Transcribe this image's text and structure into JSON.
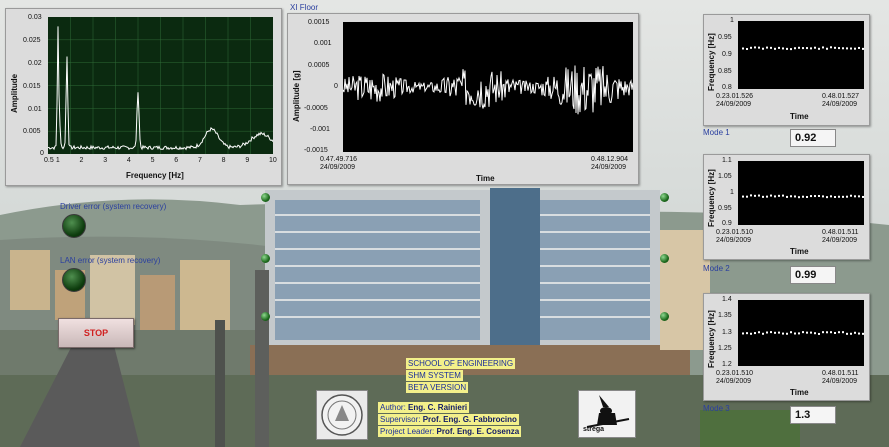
{
  "spectrum": {
    "ylabel": "Amplitude",
    "xlabel": "Frequency [Hz]",
    "yticks": [
      "0.03",
      "0.025",
      "0.02",
      "0.015",
      "0.01",
      "0.005",
      "0"
    ],
    "xticks": [
      "0.5",
      "1",
      "2",
      "3",
      "4",
      "5",
      "6",
      "7",
      "8",
      "9",
      "10"
    ]
  },
  "timeseries": {
    "title": "XI Floor",
    "ylabel": "Amplitude [g]",
    "xlabel": "Time",
    "yticks": [
      "0.0015",
      "0.001",
      "0.0005",
      "0",
      "-0.0005",
      "-0.001",
      "-0.0015"
    ],
    "x_start": "0.47.49.716",
    "x_end": "0.48.12.904",
    "date_start": "24/09/2009",
    "date_end": "24/09/2009"
  },
  "modes": [
    {
      "label": "Mode 1",
      "value": "0.92",
      "ylabel": "Frequency [Hz]",
      "xlabel": "Time",
      "yticks": [
        "1",
        "0.95",
        "0.9",
        "0.85",
        "0.8"
      ],
      "x_start": "0.23.01.526",
      "x_end": "0.48.01.527",
      "date_start": "24/09/2009",
      "date_end": "24/09/2009"
    },
    {
      "label": "Mode 2",
      "value": "0.99",
      "ylabel": "Frequency [Hz]",
      "xlabel": "Time",
      "yticks": [
        "1.1",
        "1.05",
        "1",
        "0.95",
        "0.9"
      ],
      "x_start": "0.23.01.510",
      "x_end": "0.48.01.511",
      "date_start": "24/09/2009",
      "date_end": "24/09/2009"
    },
    {
      "label": "Mode 3",
      "value": "1.3",
      "ylabel": "Frequency [Hz]",
      "xlabel": "Time",
      "yticks": [
        "1.4",
        "1.35",
        "1.3",
        "1.25",
        "1.2"
      ],
      "x_start": "0.23.01.510",
      "x_end": "0.48.01.511",
      "date_start": "24/09/2009",
      "date_end": "24/09/2009"
    }
  ],
  "indicators": {
    "driver_error": "Driver error (system recovery)",
    "lan_error": "LAN error (system recovery)"
  },
  "stop_label": "STOP",
  "info": {
    "school": "SCHOOL OF ENGINEERING",
    "system": "SHM SYSTEM",
    "version": "BETA VERSION",
    "author_key": "Author:",
    "author_val": "Eng. C. Rainieri",
    "supervisor_key": "Supervisor:",
    "supervisor_val": "Prof. Eng. G. Fabbrocino",
    "leader_key": "Project Leader:",
    "leader_val": "Prof. Eng. E. Cosenza"
  },
  "logo_text": "strega",
  "colors": {
    "plot_bg": "#000000",
    "spectrum_bg": "#0b2a10",
    "trace": "#ffffff",
    "label_blue": "#2a3f9f",
    "info_yellow": "#f3f08a"
  }
}
